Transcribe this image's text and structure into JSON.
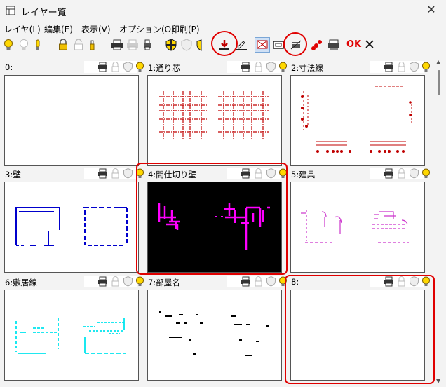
{
  "window": {
    "title": "レイヤー覧"
  },
  "menu": [
    {
      "label": "レイヤ(L)"
    },
    {
      "label": "編集(E)"
    },
    {
      "label": "表示(V)"
    },
    {
      "label": "オプション(O)"
    },
    {
      "label": "印刷(P)"
    }
  ],
  "toolbar": {
    "ok_label": "OK"
  },
  "layers": [
    {
      "label": "0:"
    },
    {
      "label": "1:通り芯"
    },
    {
      "label": "2:寸法線"
    },
    {
      "label": "3:壁"
    },
    {
      "label": "4:間仕切り壁"
    },
    {
      "label": "5:建具"
    },
    {
      "label": "6:敷居線"
    },
    {
      "label": "7:部屋名"
    },
    {
      "label": "8:"
    }
  ],
  "colors": {
    "axis": "#c00000",
    "dim": "#c00000",
    "wall": "#0000cc",
    "partition": "#ff00ff",
    "fitting": "#cc33cc",
    "sill": "#00e5ee",
    "roomname": "#000000",
    "highlight": "#e00000"
  }
}
